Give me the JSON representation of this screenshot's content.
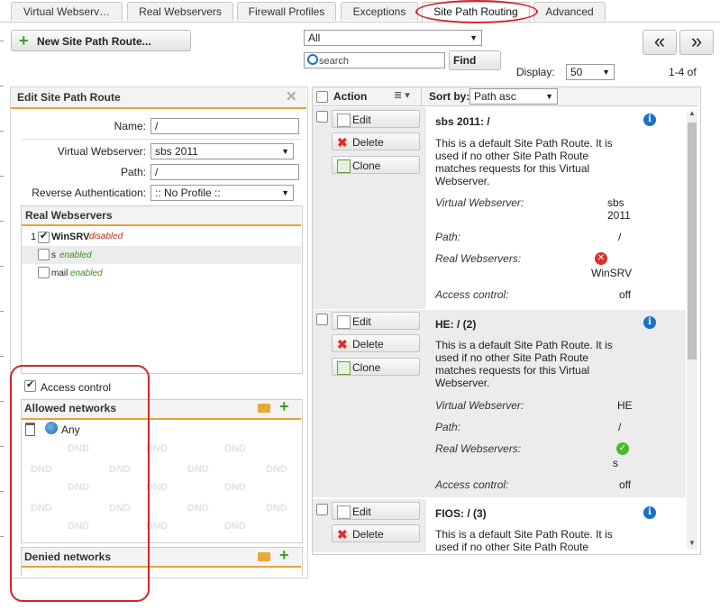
{
  "tabs": [
    {
      "label": "Virtual Webserv…"
    },
    {
      "label": "Real Webservers"
    },
    {
      "label": "Firewall Profiles"
    },
    {
      "label": "Exceptions"
    },
    {
      "label": "Site Path Routing"
    },
    {
      "label": "Advanced"
    }
  ],
  "toolbar": {
    "new_button": "New Site Path Route...",
    "filter_value": "All",
    "search_placeholder": "search",
    "find_button": "Find",
    "display_label": "Display:",
    "display_value": "50",
    "range": "1-4 of",
    "prev": "«",
    "next": "»"
  },
  "edit_panel": {
    "title": "Edit Site Path Route",
    "name_label": "Name:",
    "name_value": "/",
    "vws_label": "Virtual Webserver:",
    "vws_value": "sbs 2011",
    "path_label": "Path:",
    "path_value": "/",
    "auth_label": "Reverse Authentication:",
    "auth_value": ":: No Profile ::",
    "real_title": "Real Webservers",
    "real_items": [
      {
        "index": "1",
        "name": "WinSRV",
        "status": "disabled"
      },
      {
        "index": "",
        "name": "s",
        "status": "enabled"
      },
      {
        "index": "",
        "name": "mail",
        "status": "enabled"
      }
    ],
    "access_label": "Access control",
    "allowed_title": "Allowed networks",
    "allowed_item": "Any",
    "dnd": "DND",
    "denied_title": "Denied networks"
  },
  "list": {
    "action_header": "Action",
    "sort_label": "Sort by:",
    "sort_value": "Path asc",
    "edit": "Edit",
    "delete": "Delete",
    "clone": "Clone",
    "desc": "This is a default Site Path Route. It is used if no other Site Path Route matches requests for this Virtual Webserver.",
    "k_vws": "Virtual Webserver:",
    "k_path": "Path:",
    "k_real": "Real Webservers:",
    "k_access": "Access control:",
    "items": [
      {
        "title": "sbs 2011: /",
        "vws": "sbs 2011",
        "path": "/",
        "real": "WinSRV",
        "access": "off"
      },
      {
        "title": "HE: / (2)",
        "vws": "HE",
        "path": "/",
        "real": "s",
        "access": "off"
      },
      {
        "title": "FIOS: / (3)"
      }
    ]
  },
  "colors": {
    "accent": "#e8a23c",
    "highlight": "#d0262a",
    "info": "#1a72c6",
    "ok": "#4cb82f",
    "error": "#d9322b"
  }
}
